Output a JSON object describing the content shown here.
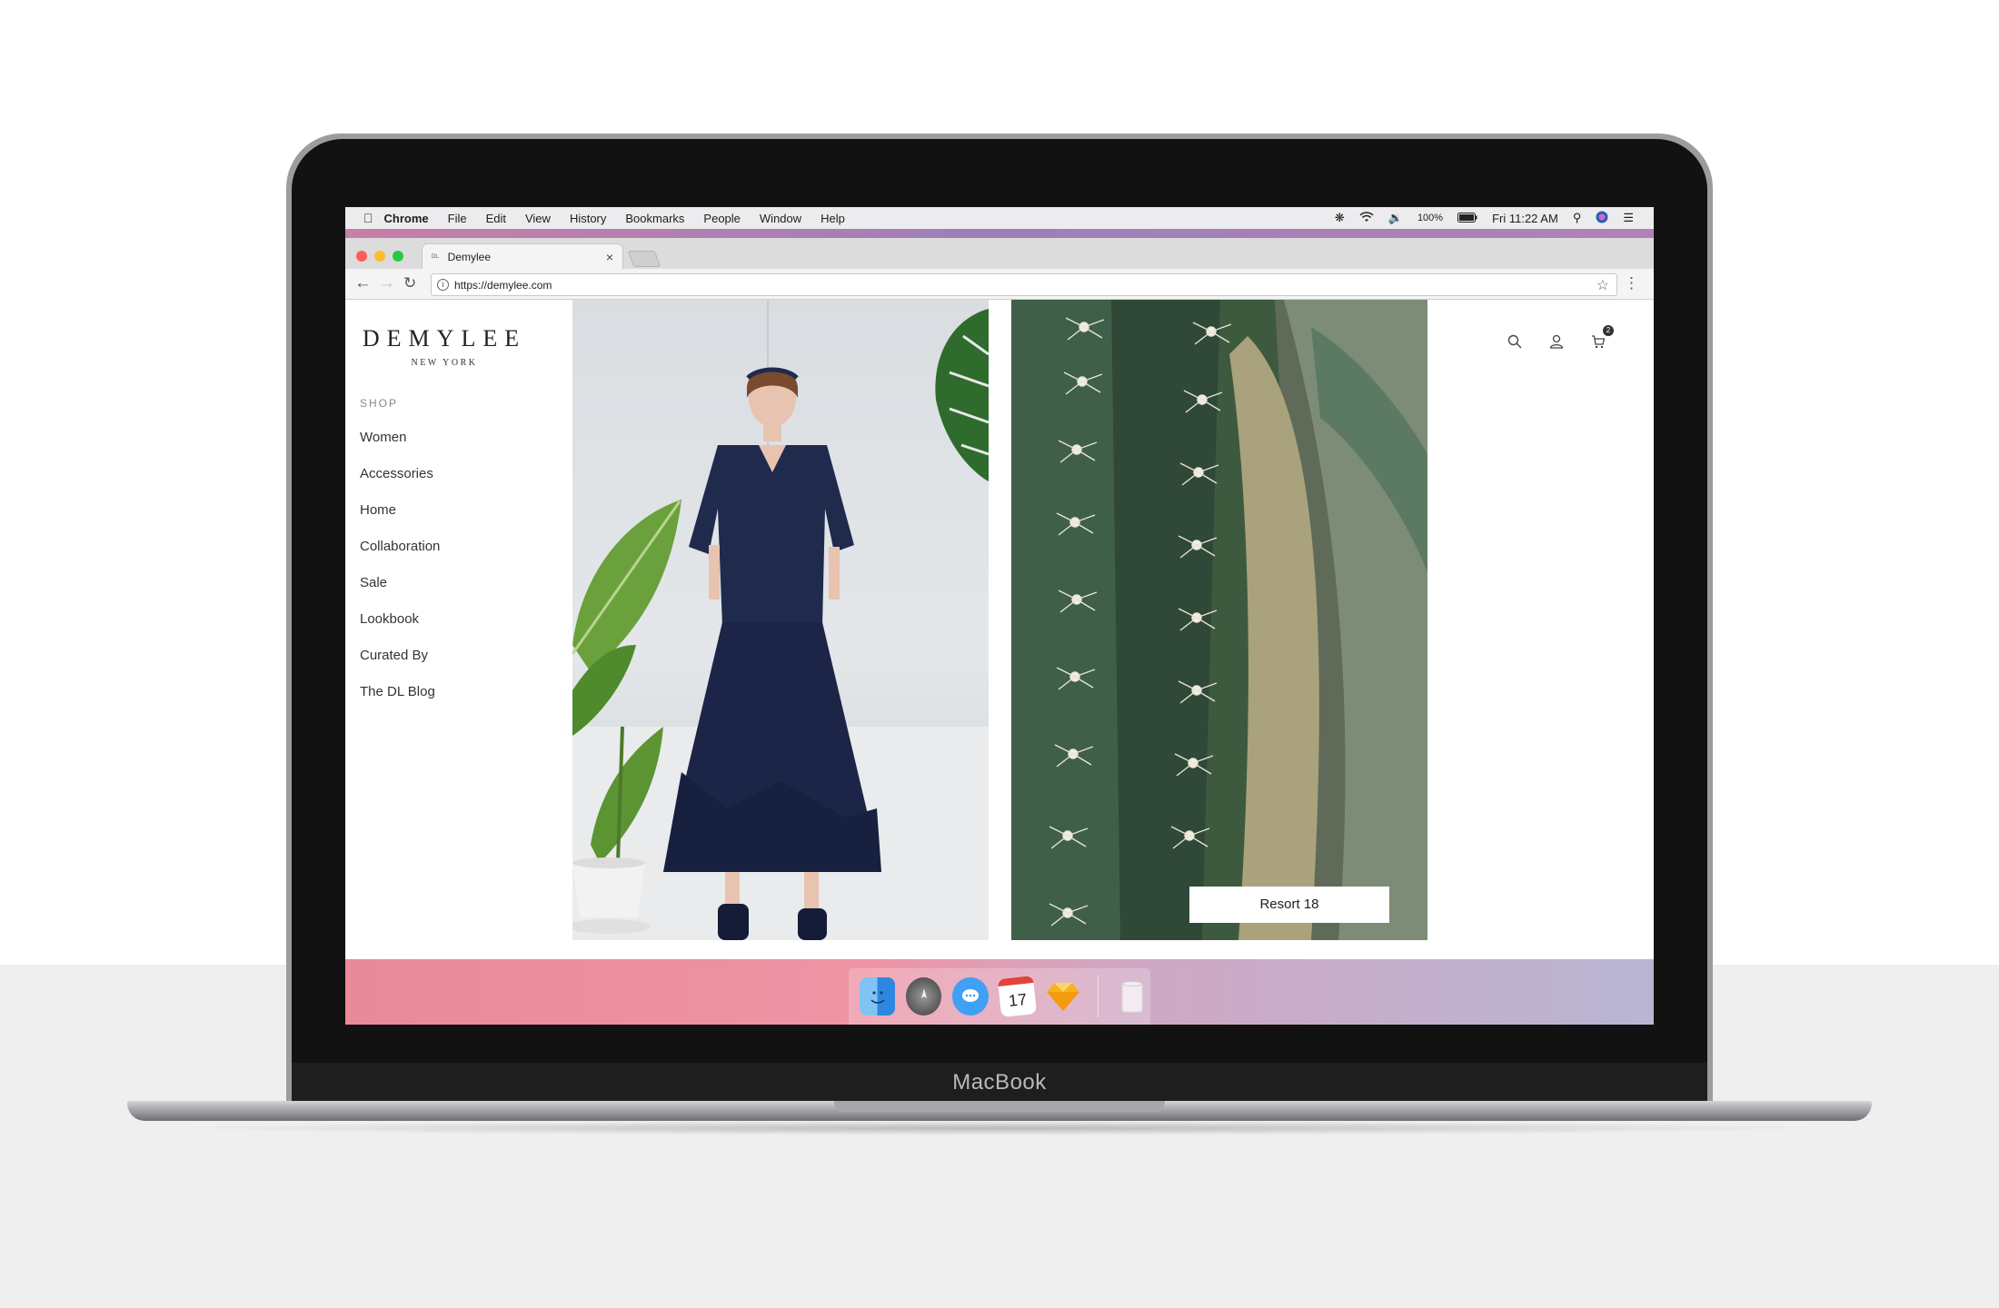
{
  "device": {
    "brand_label": "MacBook"
  },
  "menubar": {
    "app_name": "Chrome",
    "items": [
      "File",
      "Edit",
      "View",
      "History",
      "Bookmarks",
      "People",
      "Window",
      "Help"
    ],
    "battery": "100%",
    "clock": "Fri 11:22 AM"
  },
  "browser": {
    "tab_title": "Demylee",
    "tab_favicon": "DL",
    "url": "https://demylee.com"
  },
  "site": {
    "logo": {
      "name": "DEMYLEE",
      "sub": "NEW YORK"
    },
    "nav_heading": "SHOP",
    "nav_items": [
      "Women",
      "Accessories",
      "Home",
      "Collaboration",
      "Sale",
      "Lookbook",
      "Curated By",
      "The DL Blog"
    ],
    "cart_count": "2",
    "hero_right_button": "Resort 18"
  },
  "dock": {
    "items": [
      "finder-icon",
      "launchpad-icon",
      "messages-icon",
      "calendar-icon",
      "sketch-icon",
      "trash-icon"
    ],
    "calendar_day": "17"
  },
  "colors": {
    "accent_navy": "#1f2a4d",
    "wallpaper_pink": "#ee94a5",
    "wallpaper_lavender": "#b9b6d2"
  }
}
